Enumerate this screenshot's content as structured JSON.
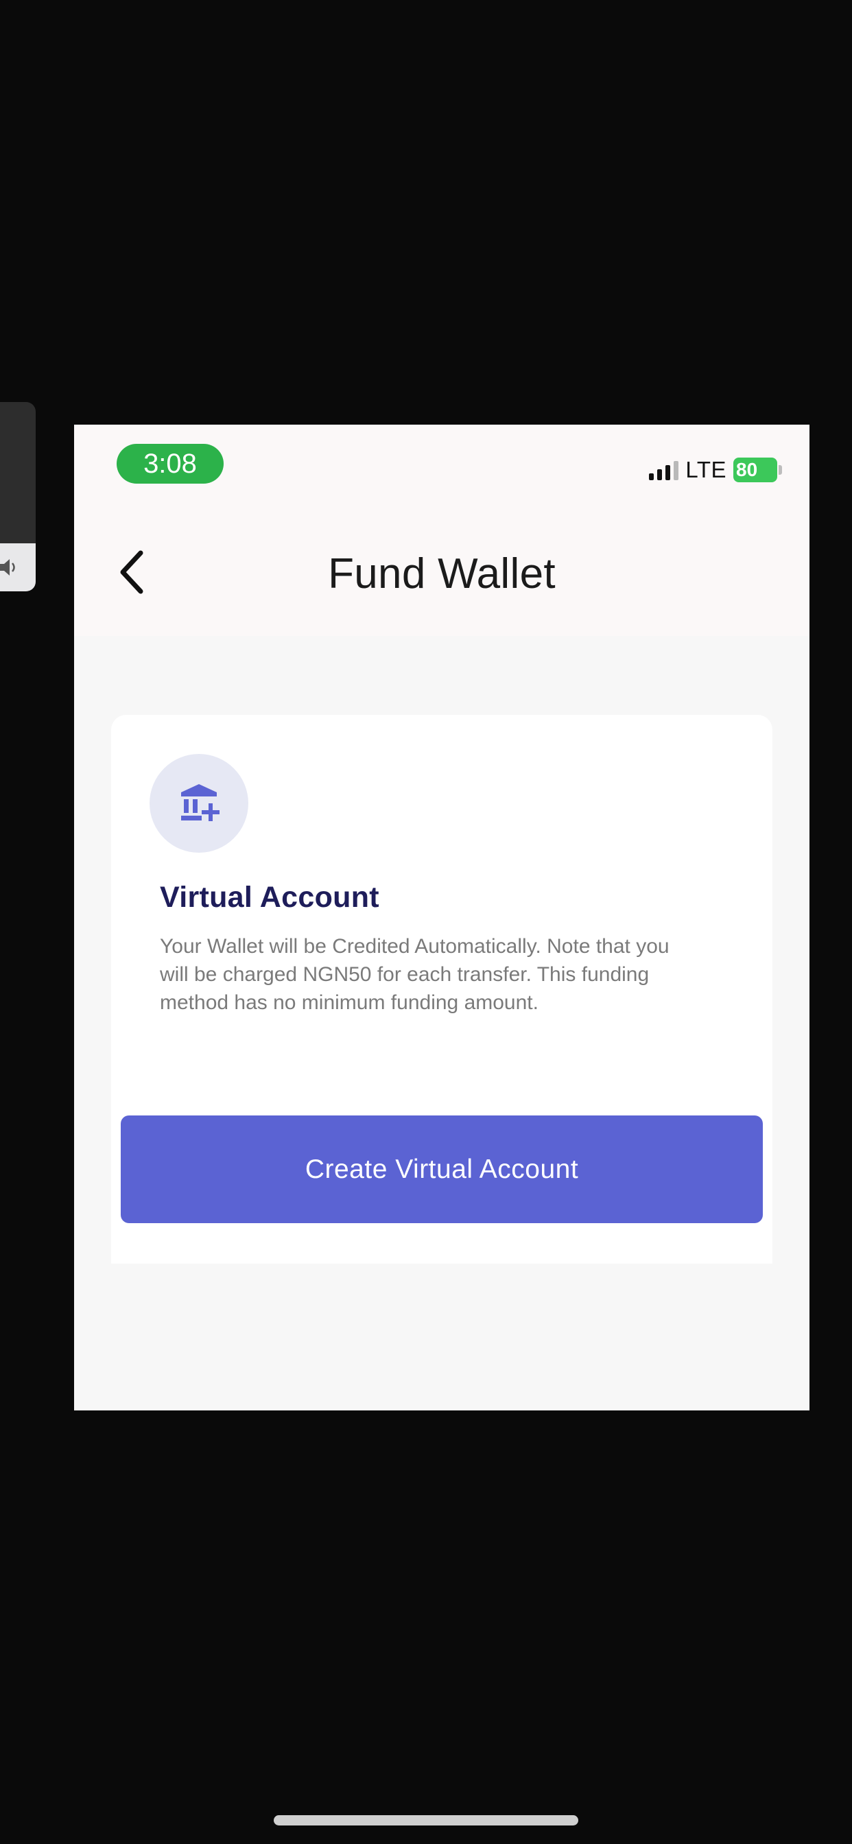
{
  "status_bar": {
    "time": "3:08",
    "network": "LTE",
    "battery": "80",
    "colors": {
      "time_pill": "#2cb24a",
      "battery": "#3cc85a"
    }
  },
  "header": {
    "title": "Fund Wallet",
    "back_icon": "chevron-left-icon"
  },
  "card": {
    "icon": "bank-add-icon",
    "title": "Virtual Account",
    "description": "Your Wallet will be Credited Automatically. Note that you will be charged NGN50 for each transfer. This funding method has no minimum funding amount.",
    "button_label": "Create Virtual Account"
  },
  "colors": {
    "accent": "#5b63d3",
    "title_text": "#1e1d5a",
    "badge_bg": "#e6e8f4"
  }
}
